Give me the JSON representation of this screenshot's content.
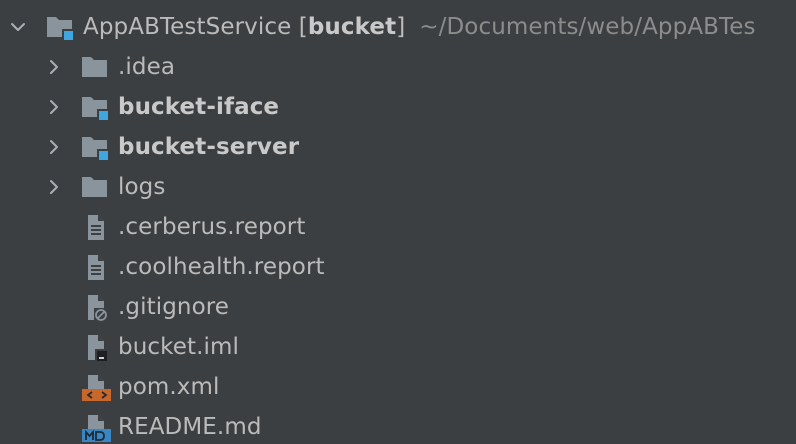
{
  "project_tree": {
    "root": {
      "name": "AppABTestService",
      "module_open": "[",
      "module": "bucket",
      "module_close": "]",
      "path": "~/Documents/web/AppABTes",
      "expanded": true
    },
    "items": [
      {
        "label": ".idea",
        "type": "folder",
        "bold": false,
        "expandable": true
      },
      {
        "label": "bucket-iface",
        "type": "module-folder",
        "bold": true,
        "expandable": true
      },
      {
        "label": "bucket-server",
        "type": "module-folder",
        "bold": true,
        "expandable": true
      },
      {
        "label": "logs",
        "type": "folder",
        "bold": false,
        "expandable": true
      },
      {
        "label": ".cerberus.report",
        "type": "text-file",
        "bold": false,
        "expandable": false
      },
      {
        "label": ".coolhealth.report",
        "type": "text-file",
        "bold": false,
        "expandable": false
      },
      {
        "label": ".gitignore",
        "type": "ignored-file",
        "bold": false,
        "expandable": false
      },
      {
        "label": "bucket.iml",
        "type": "iml-file",
        "bold": false,
        "expandable": false
      },
      {
        "label": "pom.xml",
        "type": "xml-file",
        "bold": false,
        "expandable": false
      },
      {
        "label": "README.md",
        "type": "markdown-file",
        "bold": false,
        "expandable": false
      }
    ]
  },
  "colors": {
    "background": "#3c3f41",
    "text": "#bbbbbb",
    "path_text": "#8c8c8c",
    "folder": "#8a949c",
    "module_badge": "#3fa7e0",
    "xml_badge": "#c8672b",
    "md_badge": "#3a86c4"
  }
}
